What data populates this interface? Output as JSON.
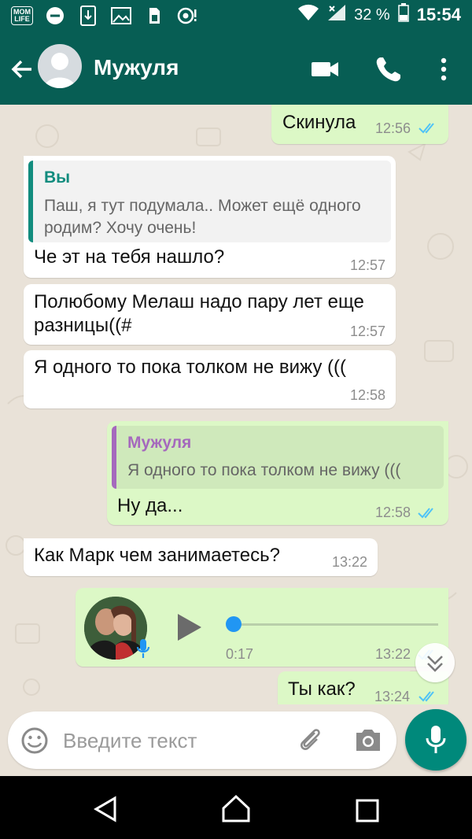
{
  "status_bar": {
    "left_icons": [
      "momlife-icon",
      "minus-circle-icon",
      "download-icon",
      "image-icon",
      "sim-icon",
      "record-icon"
    ],
    "momlife_text": "MOM\nLIFE",
    "battery": "32 %",
    "time": "15:54"
  },
  "header": {
    "contact_name": "Мужуля"
  },
  "messages": [
    {
      "dir": "out",
      "text": "Скинула",
      "time": "12:56",
      "read": true
    },
    {
      "dir": "in",
      "quote_author": "Вы",
      "quote_text": "Паш, я тут подумала.. Может ещё одного родим? Хочу очень!",
      "text": "Че эт на тебя нашло?",
      "time": "12:57"
    },
    {
      "dir": "in",
      "text": "Полюбому Мелаш надо пару лет еще разницы((#",
      "time": "12:57"
    },
    {
      "dir": "in",
      "text": "Я одного то пока толком не вижу (((",
      "time": "12:58"
    },
    {
      "dir": "out",
      "quote_author": "Мужуля",
      "quote_text": "Я одного то пока толком не вижу (((",
      "text": "Ну да...",
      "time": "12:58",
      "read": true
    },
    {
      "dir": "in",
      "text": "Как Марк чем занимаетесь?",
      "time": "13:22"
    },
    {
      "dir": "out",
      "type": "voice",
      "duration": "0:17",
      "time": "13:22",
      "progress": 0,
      "read": true
    },
    {
      "dir": "out",
      "text": "Ты как?",
      "time": "13:24",
      "read": true
    }
  ],
  "input": {
    "placeholder": "Введите текст"
  },
  "colors": {
    "header": "#075e54",
    "outgoing": "#dcf8c6",
    "incoming": "#ffffff",
    "accent": "#00897b",
    "read_ticks": "#4fc3f7",
    "quote_self": "#128c7e",
    "quote_contact": "#a569bd"
  }
}
